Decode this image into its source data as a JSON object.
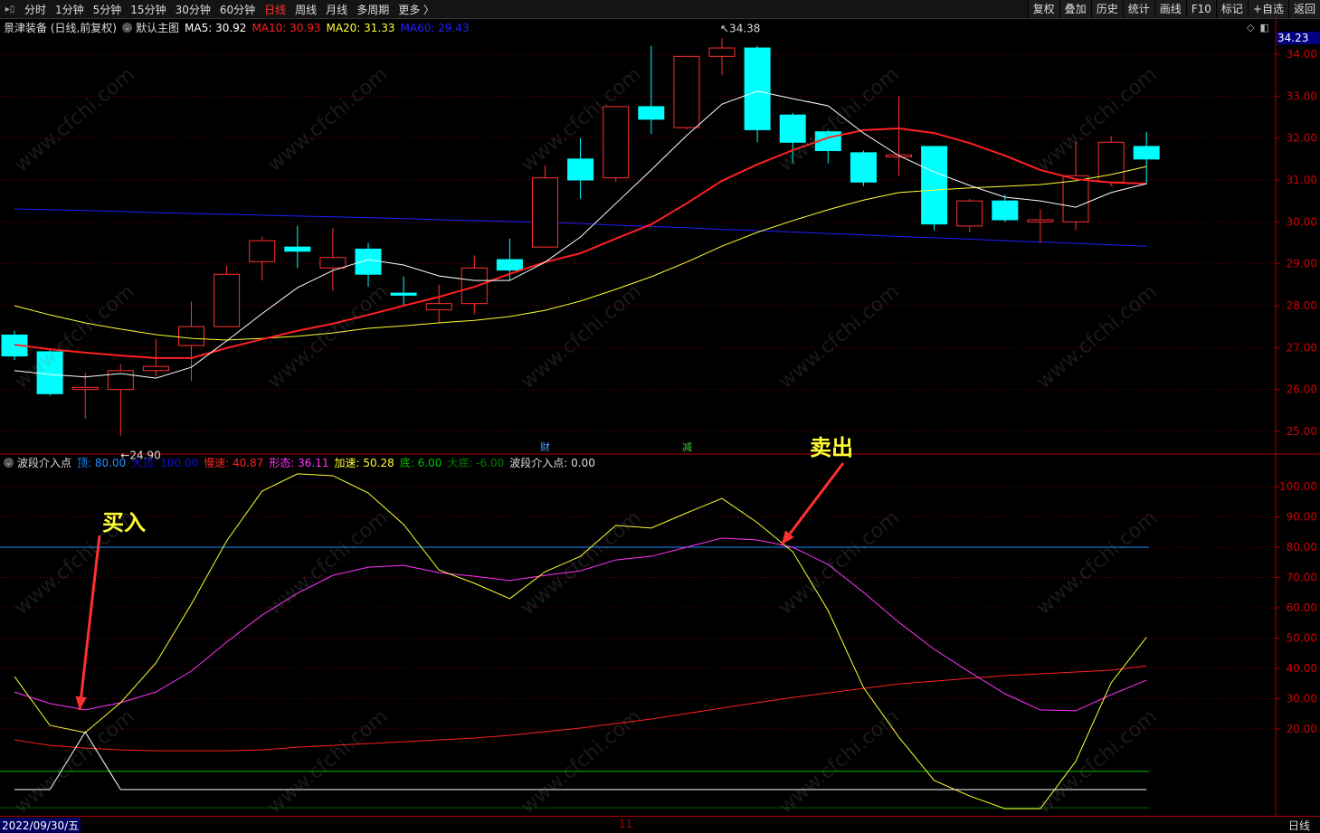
{
  "toolbar": {
    "periods": [
      "分时",
      "1分钟",
      "5分钟",
      "15分钟",
      "30分钟",
      "60分钟",
      "日线",
      "周线",
      "月线",
      "多周期",
      "更多 〉"
    ],
    "active_period": "日线",
    "buttons": [
      "复权",
      "叠加",
      "历史",
      "统计",
      "画线",
      "F10",
      "标记",
      "+自选",
      "返回"
    ]
  },
  "main_legend": {
    "stock": "景津装备 (日线,前复权)",
    "template": "默认主图",
    "ma5": "MA5: 30.92",
    "ma10": "MA10: 30.93",
    "ma20": "MA20: 31.33",
    "ma60": "MA60: 29.43"
  },
  "current_price": "34.23",
  "high_label": "34.38",
  "low_label": "←24.90",
  "event_marks": [
    {
      "text": "财",
      "color": "#4aa0ff"
    },
    {
      "text": "减",
      "color": "#33cc33"
    }
  ],
  "indicator_legend": {
    "name": "波段介入点",
    "top": "顶: 80.00",
    "big_top": "大顶: 100.00",
    "slow": "慢速: 40.87",
    "shape": "形态: 36.11",
    "accel": "加速: 50.28",
    "bottom": "底: 6.00",
    "big_bottom": "大底: -6.00",
    "entry": "波段介入点: 0.00"
  },
  "annotations": {
    "buy": "买入",
    "sell": "卖出"
  },
  "bottom_axis": {
    "date": "2022/09/30/五",
    "month": "11",
    "period": "日线"
  },
  "watermark": "www.cfchi.com",
  "colors": {
    "up": "#ff3030",
    "down": "#00ffff",
    "ma5": "#ffffff",
    "ma10": "#ff2020",
    "ma20": "#ffff33",
    "ma60": "#2020ff",
    "slow": "#ff2020",
    "shape": "#ff33ff",
    "accel": "#ffff33",
    "top": "#1e90ff",
    "bottom": "#00c000",
    "entry": "#ffffff"
  },
  "chart_data": [
    {
      "type": "candlestick",
      "title": "景津装备 日线",
      "ylim": [
        24.6,
        34.7
      ],
      "yticks": [
        34,
        33,
        32,
        31,
        30,
        29,
        28,
        27,
        26,
        25
      ],
      "ohlc": [
        [
          27.3,
          27.4,
          26.7,
          26.8
        ],
        [
          26.9,
          26.95,
          25.85,
          25.9
        ],
        [
          26.0,
          26.4,
          25.3,
          26.05
        ],
        [
          26.0,
          26.6,
          24.9,
          26.45
        ],
        [
          26.45,
          27.2,
          26.3,
          26.55
        ],
        [
          27.05,
          28.1,
          26.2,
          27.5
        ],
        [
          27.5,
          28.95,
          27.5,
          28.75
        ],
        [
          29.05,
          29.65,
          28.6,
          29.55
        ],
        [
          29.4,
          29.9,
          28.9,
          29.3
        ],
        [
          28.9,
          29.85,
          28.35,
          29.15
        ],
        [
          29.35,
          29.5,
          28.45,
          28.75
        ],
        [
          28.3,
          28.7,
          28.0,
          28.25
        ],
        [
          27.9,
          28.5,
          27.6,
          28.05
        ],
        [
          28.05,
          29.2,
          27.8,
          28.9
        ],
        [
          29.1,
          29.6,
          28.6,
          28.85
        ],
        [
          29.4,
          31.35,
          29.4,
          31.05
        ],
        [
          31.5,
          32.0,
          30.55,
          31.0
        ],
        [
          31.05,
          32.75,
          30.95,
          32.75
        ],
        [
          32.75,
          34.2,
          32.1,
          32.45
        ],
        [
          32.25,
          33.95,
          32.2,
          33.95
        ],
        [
          33.95,
          34.38,
          33.5,
          34.15
        ],
        [
          34.15,
          34.2,
          31.9,
          32.2
        ],
        [
          32.55,
          32.6,
          31.4,
          31.9
        ],
        [
          32.15,
          32.2,
          31.4,
          31.7
        ],
        [
          31.65,
          31.7,
          30.85,
          30.95
        ],
        [
          31.55,
          33.0,
          31.1,
          31.6
        ],
        [
          31.8,
          31.8,
          29.8,
          29.95
        ],
        [
          29.9,
          30.55,
          29.75,
          30.5
        ],
        [
          30.5,
          30.65,
          30.0,
          30.05
        ],
        [
          30.0,
          30.3,
          29.5,
          30.05
        ],
        [
          30.0,
          31.9,
          29.8,
          31.1
        ],
        [
          30.95,
          32.05,
          30.85,
          31.9
        ],
        [
          31.8,
          32.15,
          30.9,
          31.5
        ]
      ],
      "ma5": [
        26.45,
        26.36,
        26.3,
        26.38,
        26.27,
        26.53,
        27.16,
        27.81,
        28.43,
        28.84,
        29.1,
        28.97,
        28.71,
        28.6,
        28.6,
        29.04,
        29.64,
        30.44,
        31.24,
        32.06,
        32.81,
        33.12,
        32.94,
        32.77,
        32.12,
        31.58,
        31.19,
        30.87,
        30.59,
        30.5,
        30.35,
        30.7,
        30.91
      ],
      "ma10": [
        27.07,
        26.96,
        26.88,
        26.81,
        26.75,
        26.75,
        26.99,
        27.2,
        27.4,
        27.57,
        27.78,
        28.0,
        28.21,
        28.45,
        28.76,
        29.04,
        29.25,
        29.6,
        29.94,
        30.44,
        30.98,
        31.37,
        31.71,
        32.01,
        32.19,
        32.23,
        32.12,
        31.88,
        31.58,
        31.24,
        31.02,
        30.94,
        30.91
      ],
      "ma20": [
        28.0,
        27.78,
        27.59,
        27.44,
        27.31,
        27.22,
        27.18,
        27.22,
        27.27,
        27.35,
        27.46,
        27.52,
        27.59,
        27.65,
        27.74,
        27.89,
        28.11,
        28.39,
        28.69,
        29.04,
        29.42,
        29.75,
        30.03,
        30.29,
        30.52,
        30.7,
        30.76,
        30.81,
        30.85,
        30.89,
        30.98,
        31.13,
        31.32
      ],
      "ma60": [
        30.31,
        30.29,
        30.27,
        30.25,
        30.22,
        30.2,
        30.18,
        30.16,
        30.14,
        30.12,
        30.1,
        30.08,
        30.05,
        30.03,
        30.01,
        29.99,
        29.96,
        29.92,
        29.89,
        29.86,
        29.82,
        29.79,
        29.76,
        29.72,
        29.69,
        29.65,
        29.62,
        29.59,
        29.55,
        29.52,
        29.49,
        29.45,
        29.42
      ]
    },
    {
      "type": "line",
      "title": "波段介入点",
      "ylim": [
        -8,
        105
      ],
      "yticks": [
        100,
        90,
        80,
        70,
        60,
        50,
        40,
        30,
        20
      ],
      "levels": {
        "top": 80,
        "big_top": 100,
        "bottom": 6,
        "big_bottom": -6
      },
      "series": [
        {
          "name": "慢速",
          "values": [
            16.4,
            14.6,
            13.7,
            13.1,
            12.8,
            12.8,
            12.8,
            13.1,
            14,
            14.6,
            15.2,
            15.8,
            16.4,
            17,
            17.9,
            19.1,
            20.3,
            21.8,
            23.3,
            25.1,
            26.9,
            28.7,
            30.4,
            31.9,
            33.4,
            34.9,
            35.8,
            36.7,
            37.6,
            38.2,
            38.8,
            39.4,
            40.87
          ]
        },
        {
          "name": "形态",
          "values": [
            32.2,
            28.4,
            26.3,
            28.7,
            32.2,
            39.1,
            48.7,
            57.6,
            64.8,
            70.7,
            73.4,
            74,
            71.6,
            70.4,
            69,
            70.7,
            72.2,
            75.8,
            77,
            80,
            83,
            82.4,
            80,
            74.3,
            65.1,
            55.2,
            46.3,
            38.8,
            31.6,
            26.3,
            26,
            31.3,
            36.11
          ]
        },
        {
          "name": "加速",
          "values": [
            37.3,
            21.2,
            18.8,
            28.7,
            41.8,
            61.2,
            82.1,
            98.5,
            104.2,
            103.6,
            97.9,
            87.5,
            72.5,
            68.1,
            63,
            71.9,
            77,
            87.2,
            86.3,
            91.3,
            96.1,
            88.1,
            78.5,
            59.1,
            33.7,
            17.3,
            3,
            -2.1,
            -6.3,
            -6.3,
            9.3,
            35.2,
            50.28
          ]
        },
        {
          "name": "波段介入点",
          "values": [
            0,
            0,
            19,
            0,
            0,
            0,
            0,
            0,
            0,
            0,
            0,
            0,
            0,
            0,
            0,
            0,
            0,
            0,
            0,
            0,
            0,
            0,
            0,
            0,
            0,
            0,
            0,
            0,
            0,
            0,
            0,
            0,
            0
          ]
        }
      ]
    }
  ]
}
